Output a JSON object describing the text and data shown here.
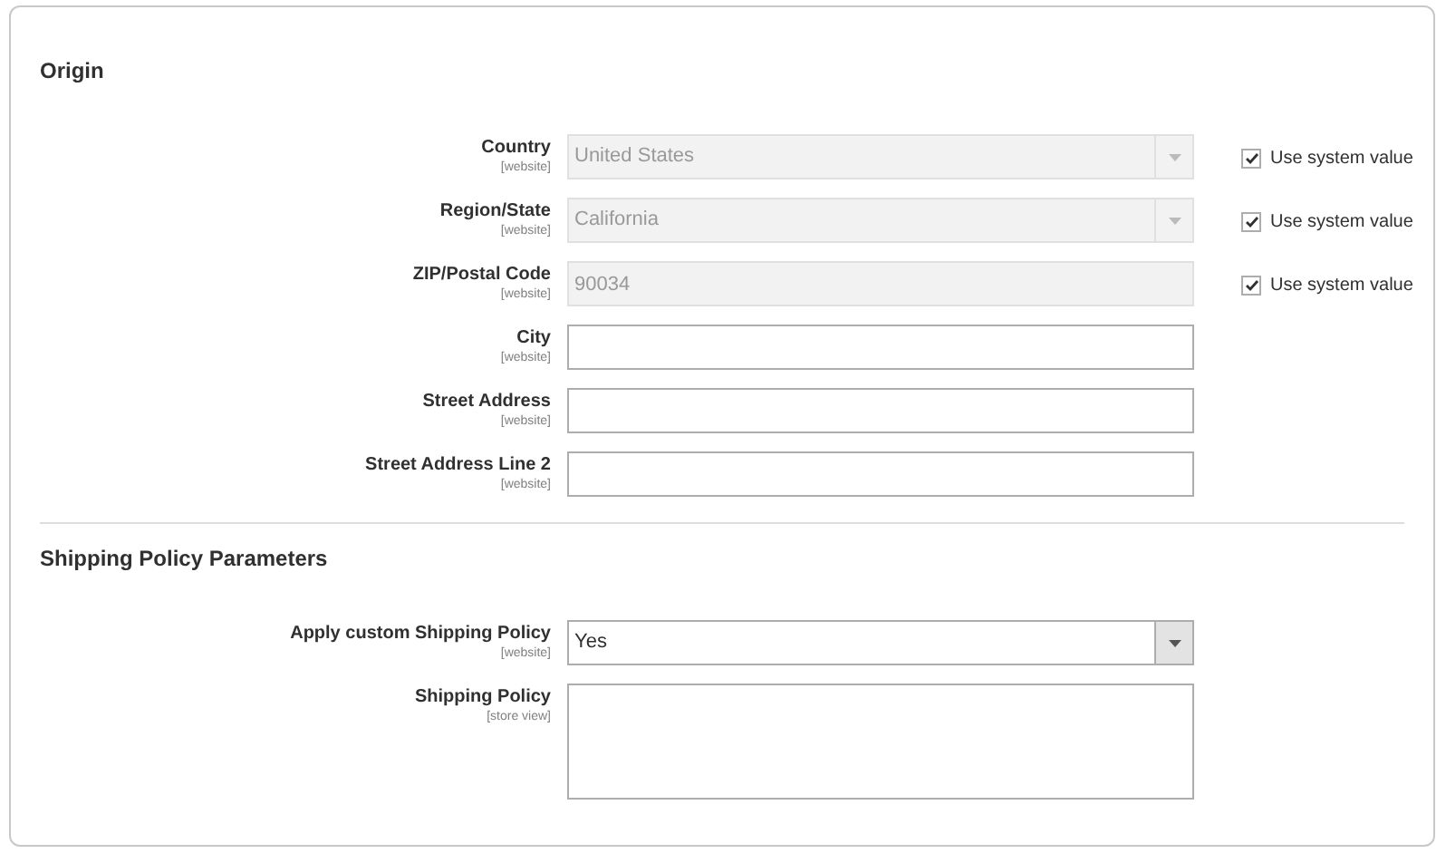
{
  "sections": [
    {
      "title": "Origin",
      "fields": [
        {
          "kind": "select",
          "label": "Country",
          "scope": "[website]",
          "value": "United States",
          "disabled": true,
          "use_system_value": {
            "label": "Use system value",
            "checked": true
          }
        },
        {
          "kind": "select",
          "label": "Region/State",
          "scope": "[website]",
          "value": "California",
          "disabled": true,
          "use_system_value": {
            "label": "Use system value",
            "checked": true
          }
        },
        {
          "kind": "text",
          "label": "ZIP/Postal Code",
          "scope": "[website]",
          "value": "90034",
          "disabled": true,
          "use_system_value": {
            "label": "Use system value",
            "checked": true
          }
        },
        {
          "kind": "text",
          "label": "City",
          "scope": "[website]",
          "disabled": false
        },
        {
          "kind": "text",
          "label": "Street Address",
          "scope": "[website]",
          "disabled": false
        },
        {
          "kind": "text",
          "label": "Street Address Line 2",
          "scope": "[website]",
          "disabled": false
        }
      ]
    },
    {
      "title": "Shipping Policy Parameters",
      "fields": [
        {
          "kind": "select",
          "label": "Apply custom Shipping Policy",
          "scope": "[website]",
          "value": "Yes",
          "disabled": false
        },
        {
          "kind": "textarea",
          "label": "Shipping Policy",
          "scope": "[store view]",
          "disabled": false
        }
      ]
    }
  ]
}
